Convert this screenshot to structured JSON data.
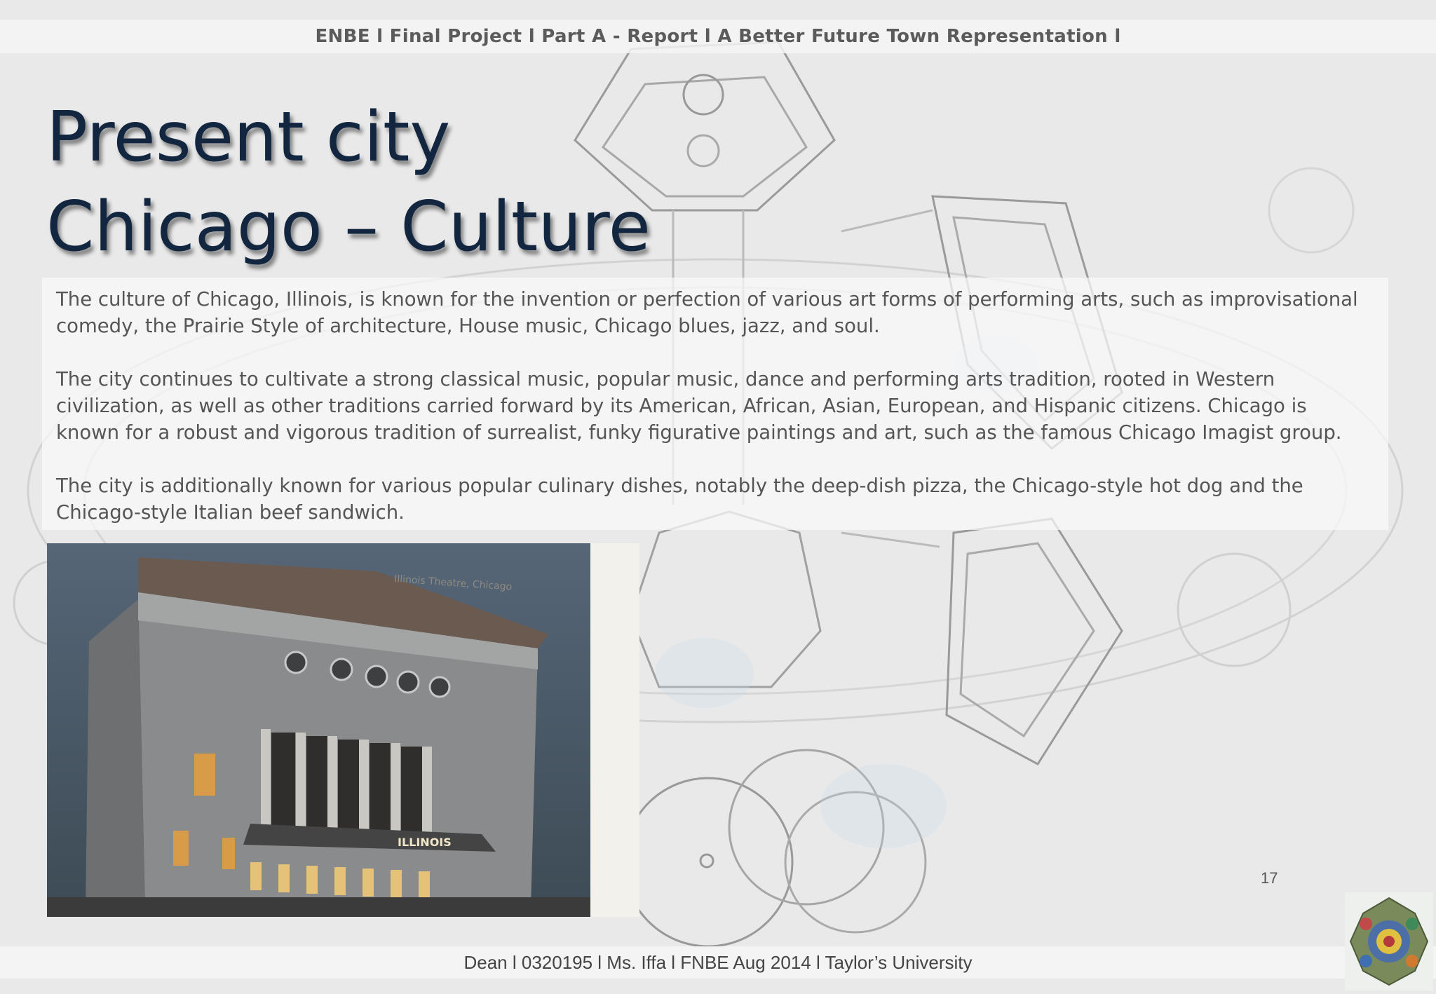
{
  "header": {
    "text": "ENBE l Final Project l Part A - Report l A Better Future Town Representation  l"
  },
  "title": {
    "line1": "Present city",
    "line2": "Chicago – Culture"
  },
  "body": {
    "paragraphs": [
      "The culture of Chicago, Illinois, is known for the invention or perfection of various art forms of performing arts, such as improvisational comedy, the Prairie Style of architecture, House music, Chicago blues, jazz, and soul.",
      "The city continues to cultivate a strong classical music, popular music, dance and performing arts tradition, rooted in Western civilization, as well as other traditions carried forward by its American, African, Asian, European, and Hispanic citizens. Chicago is known for a robust and vigorous tradition of surrealist, funky figurative paintings and art, such as the famous Chicago Imagist group.",
      "The city is additionally known for various popular culinary dishes, notably the deep-dish pizza, the Chicago-style hot dog and the Chicago-style Italian beef sandwich."
    ]
  },
  "photo": {
    "caption": "Illinois Theatre, Chicago",
    "marquee": "ILLINOIS"
  },
  "page_number": "17",
  "footer": {
    "text": "Dean l 0320195 l Ms. Iffa l FNBE Aug 2014 l Taylor’s University"
  },
  "colors": {
    "title": "#12263f",
    "header_text": "#5b5b5b",
    "body_text": "#555555",
    "background": "#e9e9e9"
  }
}
